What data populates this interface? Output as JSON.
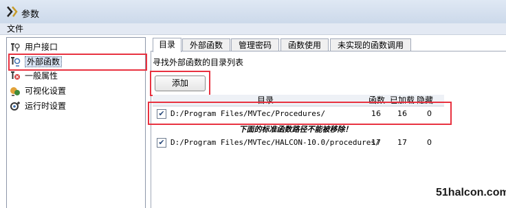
{
  "window": {
    "title": "参数"
  },
  "menu": {
    "file": "文件"
  },
  "sidebar": {
    "items": [
      {
        "label": "用户接口",
        "icon": "user-interface-icon"
      },
      {
        "label": "外部函数",
        "icon": "external-functions-icon",
        "selected": true
      },
      {
        "label": "一般属性",
        "icon": "general-properties-icon"
      },
      {
        "label": "可视化设置",
        "icon": "visualization-icon"
      },
      {
        "label": "运行时设置",
        "icon": "runtime-settings-icon"
      }
    ]
  },
  "tabs": [
    {
      "label": "目录",
      "active": true
    },
    {
      "label": "外部函数"
    },
    {
      "label": "管理密码"
    },
    {
      "label": "函数使用"
    },
    {
      "label": "未实现的函数调用"
    }
  ],
  "main": {
    "section_label": "寻找外部函数的目录列表",
    "add_button": "添加",
    "table": {
      "headers": {
        "dir": "目录",
        "funcs": "函数",
        "loaded": "已加载",
        "hidden": "隐藏"
      },
      "rows": [
        {
          "checked": true,
          "path": "D:/Program Files/MVTec/Procedures/",
          "funcs": "16",
          "loaded": "16",
          "hidden": "0"
        },
        {
          "checked": true,
          "path": "D:/Program Files/MVTec/HALCON-10.0/procedures/",
          "funcs": "17",
          "loaded": "17",
          "hidden": "0"
        }
      ]
    },
    "notice": "下面的标准函数路径不能被移除！"
  },
  "watermark": "51halcon.com",
  "colors": {
    "highlight": "#e8313f",
    "titlebar": "#dfe8f4",
    "selection": "#d9e4f3"
  }
}
